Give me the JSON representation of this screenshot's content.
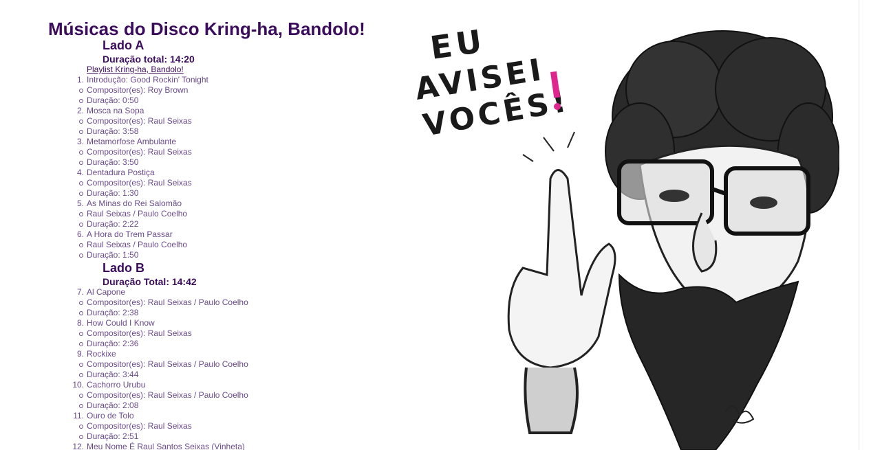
{
  "page": {
    "title": "Músicas do Disco Kring-ha, Bandolo!",
    "playlist_link": "Playlist Kring-ha, Bandolo!"
  },
  "side_a": {
    "title": "Lado A",
    "total": "Duração total: 14:20",
    "tracks": [
      {
        "number": "1.",
        "name": "Introdução: Good Rockin' Tonight",
        "composer": "Compositor(es): Roy Brown",
        "duration": "Duração: 0:50"
      },
      {
        "number": "2.",
        "name": "Mosca na Sopa",
        "composer": "Compositor(es): Raul Seixas",
        "duration": "Duração: 3:58"
      },
      {
        "number": "3.",
        "name": "Metamorfose Ambulante",
        "composer": "Compositor(es): Raul Seixas",
        "duration": "Duração: 3:50"
      },
      {
        "number": "4.",
        "name": "Dentadura Postiça",
        "composer": "Compositor(es): Raul Seixas",
        "duration": "Duração: 1:30"
      },
      {
        "number": "5.",
        "name": "As Minas do Rei Salomão",
        "composer": "Raul Seixas / Paulo Coelho",
        "duration": "Duração: 2:22"
      },
      {
        "number": "6.",
        "name": "A Hora do Trem Passar",
        "composer": "Raul Seixas / Paulo Coelho",
        "duration": "Duração: 1:50"
      }
    ]
  },
  "side_b": {
    "title": "Lado B",
    "total": "Duração Total: 14:42",
    "tracks": [
      {
        "number": "7.",
        "name": "Al Capone",
        "composer": "Compositor(es): Raul Seixas / Paulo Coelho",
        "duration": "Duração: 2:38"
      },
      {
        "number": "8.",
        "name": "How Could I Know",
        "composer": "Compositor(es): Raul Seixas",
        "duration": "Duração: 2:36"
      },
      {
        "number": "9.",
        "name": "Rockixe",
        "composer": "Compositor(es): Raul Seixas / Paulo Coelho",
        "duration": "Duração: 3:44"
      },
      {
        "number": "10.",
        "name": "Cachorro Urubu",
        "composer": "Compositor(es): Raul Seixas / Paulo Coelho",
        "duration": "Duração: 2:08"
      },
      {
        "number": "11.",
        "name": "Ouro de Tolo",
        "composer": "Compositor(es): Raul Seixas",
        "duration": "Duração: 2:51"
      },
      {
        "number": "12.",
        "name": "Meu Nome É Raul Santos Seixas (Vinheta)",
        "composer": "",
        "duration": ""
      }
    ]
  },
  "artwork": {
    "caption_line1": "EU",
    "caption_line2": "AVISEI",
    "caption_line3": "VOCÊS!",
    "exclamation_color": "#e0258f",
    "ink_color": "#1a1a1a"
  }
}
